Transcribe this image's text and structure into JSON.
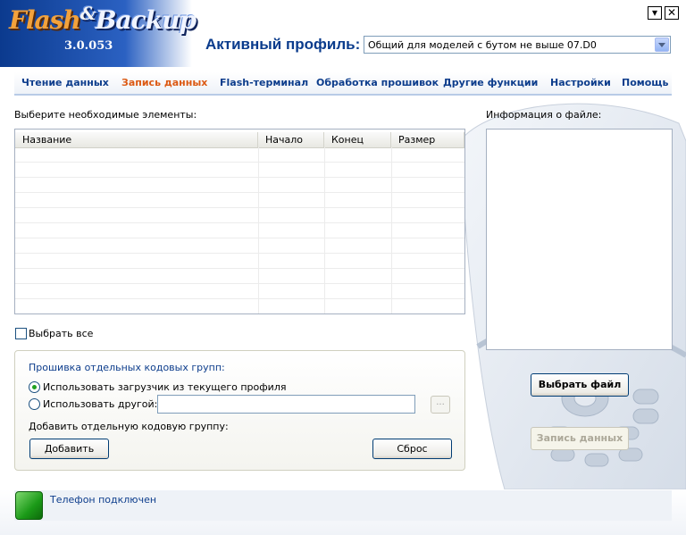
{
  "header": {
    "logo_flash": "Flash",
    "logo_amp": "&",
    "logo_backup": "Backup",
    "version": "3.0.053",
    "profile_label": "Активный профиль:",
    "profile_value": "Общий для моделей с бутом не выше 07.D0",
    "minimize_glyph": "▾",
    "close_glyph": "✕"
  },
  "tabs": [
    {
      "label": "Чтение данных"
    },
    {
      "label": "Запись данных"
    },
    {
      "label": "Flash-терминал"
    },
    {
      "label": "Обработка прошивок"
    },
    {
      "label": "Другие функции"
    },
    {
      "label": "Настройки"
    },
    {
      "label": "Помощь"
    }
  ],
  "active_tab": "Запись данных",
  "elements": {
    "label": "Выберите необходимые элементы:",
    "columns": [
      {
        "label": "Название"
      },
      {
        "label": "Начало"
      },
      {
        "label": "Конец"
      },
      {
        "label": "Размер"
      }
    ],
    "rows": [],
    "select_all_label": "Выбрать все",
    "select_all_checked": false
  },
  "code_groups": {
    "title": "Прошивка отдельных кодовых групп:",
    "option_current": "Использовать загрузчик из текущего профиля",
    "option_other": "Использовать другой:",
    "selected_option": "option_current",
    "other_path": "",
    "browse_label": "...",
    "add_label": "Добавить отдельную кодовую группу:",
    "add_button": "Добавить",
    "reset_button": "Сброс"
  },
  "file_info": {
    "label": "Информация о файле:",
    "choose_button": "Выбрать файл",
    "write_button": "Запись данных",
    "write_enabled": false
  },
  "status": {
    "text": "Телефон подключен",
    "connected": true,
    "color": "#1b9a18"
  },
  "colors": {
    "accent": "#0d3d8c",
    "active_tab": "#dc5a14"
  }
}
